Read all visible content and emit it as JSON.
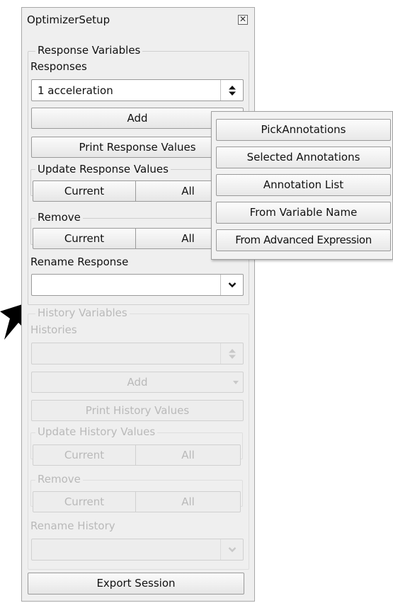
{
  "window": {
    "title": "OptimizerSetup"
  },
  "response_group": {
    "legend": "Response Variables",
    "responses_label": "Responses",
    "selected_response": "1 acceleration",
    "add_label": "Add",
    "print_label": "Print Response Values",
    "update_legend": "Update Response Values",
    "update_current": "Current",
    "update_all": "All",
    "remove_legend": "Remove",
    "remove_current": "Current",
    "remove_all": "All",
    "rename_label": "Rename Response",
    "rename_value": ""
  },
  "add_menu": {
    "items": [
      "PickAnnotations",
      "Selected Annotations",
      "Annotation List",
      "From Variable Name",
      "From Advanced Expression"
    ]
  },
  "history_group": {
    "legend": "History Variables",
    "histories_label": "Histories",
    "selected_history": "",
    "add_label": "Add",
    "print_label": "Print History Values",
    "update_legend": "Update History Values",
    "update_current": "Current",
    "update_all": "All",
    "remove_legend": "Remove",
    "remove_current": "Current",
    "remove_all": "All",
    "rename_label": "Rename History",
    "rename_value": ""
  },
  "export_label": "Export Session",
  "icons": {
    "close": "close-icon",
    "spinner": "up-down-spinner-icon",
    "dropdown": "chevron-down-icon",
    "pointer": "pointer-arrow-icon"
  },
  "colors": {
    "panel_bg": "#efefef",
    "disabled_text": "#b9b9b9",
    "border": "#9a9a9a"
  }
}
